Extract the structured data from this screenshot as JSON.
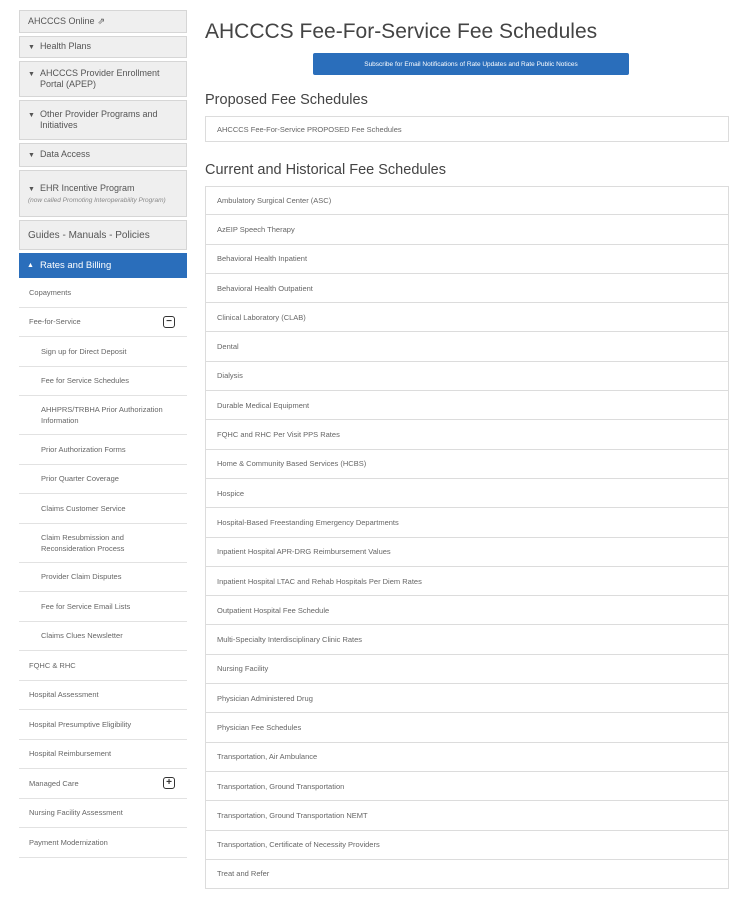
{
  "page": {
    "title": "AHCCCS Fee-For-Service Fee Schedules",
    "subscribe_label": "Subscribe for Email Notifications of Rate Updates and Rate Public Notices",
    "proposed_heading": "Proposed Fee Schedules",
    "proposed_items": [
      "AHCCCS Fee-For-Service PROPOSED Fee Schedules"
    ],
    "current_heading": "Current and Historical Fee Schedules",
    "current_items": [
      "Ambulatory Surgical Center (ASC)",
      "AzEIP Speech Therapy",
      "Behavioral Health Inpatient",
      "Behavioral Health Outpatient",
      "Clinical Laboratory (CLAB)",
      "Dental",
      "Dialysis",
      "Durable Medical Equipment",
      "FQHC and RHC Per Visit PPS Rates",
      "Home & Community Based Services (HCBS)",
      "Hospice",
      "Hospital-Based Freestanding Emergency Departments",
      "Inpatient Hospital APR-DRG Reimbursement Values",
      "Inpatient Hospital LTAC and Rehab Hospitals Per Diem Rates",
      "Outpatient Hospital Fee Schedule",
      "Multi-Specialty Interdisciplinary Clinic Rates",
      "Nursing Facility",
      "Physician Administered Drug",
      "Physician Fee Schedules",
      "Transportation, Air Ambulance",
      "Transportation, Ground Transportation",
      "Transportation, Ground Transportation NEMT",
      "Transportation, Certificate of Necessity Providers",
      "Treat and Refer"
    ]
  },
  "sidebar": {
    "top": [
      {
        "label": "AHCCCS Online",
        "caret": "",
        "ext": "⇗"
      },
      {
        "label": "Health Plans",
        "caret": "▼"
      },
      {
        "label": "AHCCCS Provider Enrollment Portal (APEP)",
        "caret": "▼"
      },
      {
        "label": "Other Provider Programs and Initiatives",
        "caret": "▼"
      },
      {
        "label": "Data Access",
        "caret": "▼"
      },
      {
        "label": "EHR Incentive Program",
        "caret": "▼",
        "sub": "(now called Promoting Interoperability Program)"
      },
      {
        "label": "Guides - Manuals - Policies"
      }
    ],
    "active": {
      "label": "Rates and Billing",
      "caret": "▲"
    },
    "items": [
      {
        "label": "Copayments"
      },
      {
        "label": "Fee-for-Service",
        "toggle": "−"
      },
      {
        "label": "Sign up for Direct Deposit",
        "indent": true
      },
      {
        "label": "Fee for Service Schedules",
        "indent": true
      },
      {
        "label": "AHHPRS/TRBHA Prior Authorization Information",
        "indent": true
      },
      {
        "label": "Prior Authorization Forms",
        "indent": true
      },
      {
        "label": "Prior Quarter Coverage",
        "indent": true
      },
      {
        "label": "Claims Customer Service",
        "indent": true
      },
      {
        "label": "Claim Resubmission and Reconsideration Process",
        "indent": true
      },
      {
        "label": "Provider Claim Disputes",
        "indent": true
      },
      {
        "label": "Fee for Service Email Lists",
        "indent": true
      },
      {
        "label": "Claims Clues Newsletter",
        "indent": true
      },
      {
        "label": "FQHC & RHC"
      },
      {
        "label": "Hospital Assessment"
      },
      {
        "label": "Hospital Presumptive Eligibility"
      },
      {
        "label": "Hospital Reimbursement"
      },
      {
        "label": "Managed Care",
        "toggle": "+"
      },
      {
        "label": "Nursing Facility Assessment"
      },
      {
        "label": "Payment Modernization"
      }
    ]
  }
}
